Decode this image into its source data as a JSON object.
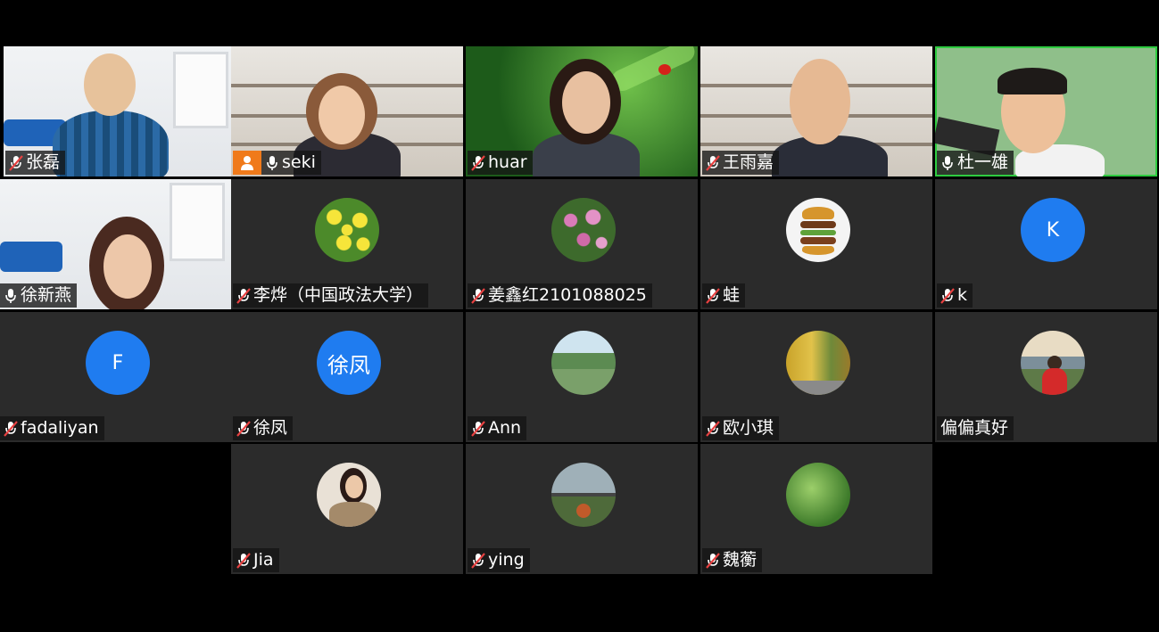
{
  "participants": [
    {
      "name": "张磊",
      "type": "video",
      "muted": true
    },
    {
      "name": "seki",
      "type": "video",
      "muted": false,
      "host_badge": true
    },
    {
      "name": "huar",
      "type": "video",
      "muted": true
    },
    {
      "name": "王雨嘉",
      "type": "video",
      "muted": true
    },
    {
      "name": "杜一雄",
      "type": "video",
      "muted": false,
      "active_speaker": true
    },
    {
      "name": "徐新燕",
      "type": "video",
      "muted": false
    },
    {
      "name": "李烨（中国政法大学）",
      "type": "avatar",
      "avatar_icon": "yellow-flowers",
      "muted": true
    },
    {
      "name": "姜鑫红2101088025",
      "type": "avatar",
      "avatar_icon": "pink-flowers",
      "muted": true
    },
    {
      "name": "蛙",
      "type": "avatar",
      "avatar_icon": "burger-stack",
      "muted": true
    },
    {
      "name": "k",
      "type": "avatar",
      "avatar_letter": "K",
      "muted": true
    },
    {
      "name": "fadaliyan",
      "type": "avatar",
      "avatar_letter": "F",
      "muted": true
    },
    {
      "name": "徐凤",
      "type": "avatar",
      "avatar_letter": "徐凤",
      "muted": true
    },
    {
      "name": "Ann",
      "type": "avatar",
      "avatar_icon": "pond-landscape",
      "muted": true
    },
    {
      "name": "欧小琪",
      "type": "avatar",
      "avatar_icon": "autumn-trees",
      "muted": true
    },
    {
      "name": "偏偏真好",
      "type": "avatar",
      "avatar_icon": "lakeside-person",
      "muted": false,
      "no_mic_icon": true
    },
    {
      "name": "Jia",
      "type": "avatar",
      "avatar_icon": "woman-portrait",
      "muted": true
    },
    {
      "name": "ying",
      "type": "avatar",
      "avatar_icon": "balcony-plants",
      "muted": true
    },
    {
      "name": "魏蘅",
      "type": "avatar",
      "avatar_icon": "green-leaves",
      "muted": true
    }
  ],
  "colors": {
    "tile_bg": "#2b2b2b",
    "letter_avatar": "#1f7cf0",
    "active_speaker_border": "#2ecc40",
    "host_badge": "#f07a1a",
    "muted_icon": "#e84141"
  }
}
